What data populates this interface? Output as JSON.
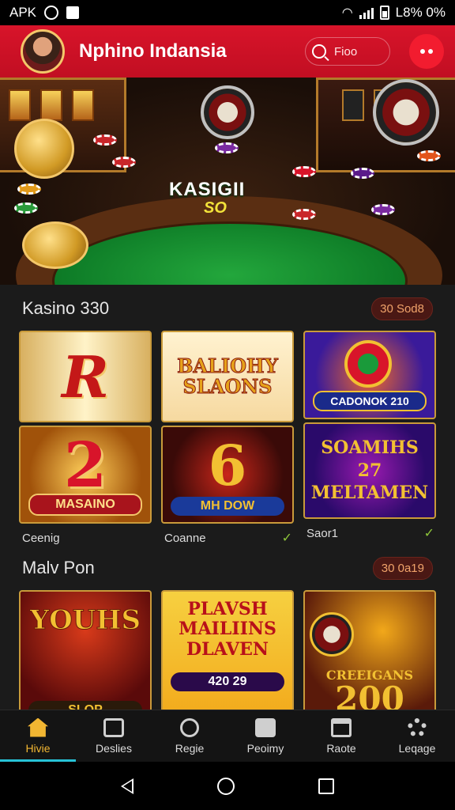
{
  "status_bar": {
    "left_text": "APK",
    "right_text": "L8% 0%"
  },
  "header": {
    "title": "Nphino Indansia",
    "search_placeholder": "Fioo"
  },
  "banner": {
    "title": "KASIGII",
    "subtitle": "SO"
  },
  "section1": {
    "title": "Kasino 330",
    "pill": "30 Sod8",
    "tiles": [
      {
        "top": "R",
        "bottom": "2",
        "bottom_caption": "MASAINO",
        "label": "Ceenig",
        "check": false
      },
      {
        "top": "BALIOHY SLAONS",
        "bottom": "6",
        "bottom_caption": "MH DOW",
        "label": "Coanne",
        "check": true
      },
      {
        "top_caption": "CADONOK 210",
        "bottom": "SOAMIHS 27 MELTAMEN",
        "label": "Saor1",
        "check": true
      }
    ]
  },
  "section2": {
    "title": "Malv Pon",
    "pill": "30 0a19",
    "tiles": [
      {
        "top": "YOUHS",
        "caption": "SLOP"
      },
      {
        "top": "PLAVSH MAILIINS DLAVEN",
        "caption": "420 29"
      },
      {
        "caption": "CREEIGANS",
        "number": "200"
      }
    ]
  },
  "nav": [
    {
      "label": "Hivie",
      "icon": "home-icon"
    },
    {
      "label": "Deslies",
      "icon": "slots-icon"
    },
    {
      "label": "Regie",
      "icon": "search-icon"
    },
    {
      "label": "Peoimy",
      "icon": "profile-icon"
    },
    {
      "label": "Raote",
      "icon": "calendar-icon"
    },
    {
      "label": "Leqage",
      "icon": "gear-icon"
    }
  ],
  "colors": {
    "header": "#d8142a",
    "accent": "#f2b632",
    "felt": "#0d7a26",
    "active_underline": "#27c2d6"
  }
}
